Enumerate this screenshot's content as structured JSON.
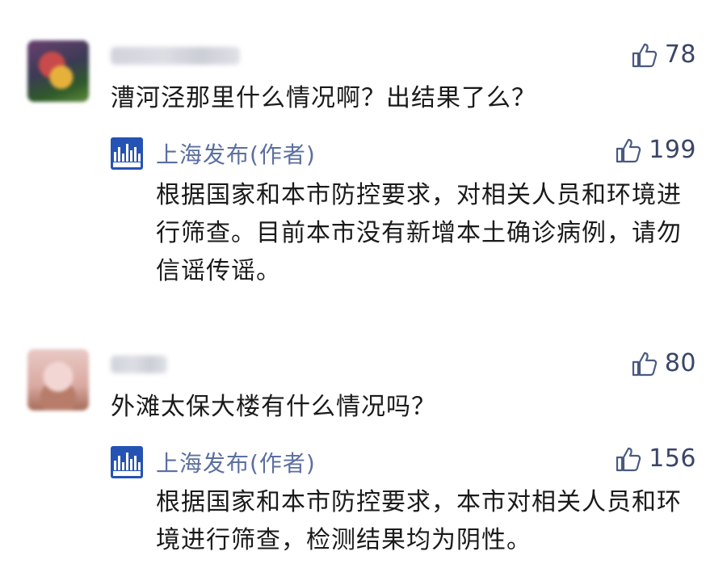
{
  "comments": [
    {
      "text": "漕河泾那里什么情况啊？出结果了么？",
      "likes": "78",
      "reply": {
        "author": "上海发布(作者)",
        "likes": "199",
        "text": "根据国家和本市防控要求，对相关人员和环境进行筛查。目前本市没有新增本土确诊病例，请勿信谣传谣。"
      }
    },
    {
      "text": "外滩太保大楼有什么情况吗？",
      "likes": "80",
      "reply": {
        "author": "上海发布(作者)",
        "likes": "156",
        "text": "根据国家和本市防控要求，本市对相关人员和环境进行筛查，检测结果均为阴性。"
      }
    }
  ],
  "colors": {
    "like_icon": "#4a5a80",
    "author_name": "#5b6fa0",
    "avatar_blue": "#2553b4"
  },
  "icons": {
    "like": "thumbs-up-icon"
  }
}
